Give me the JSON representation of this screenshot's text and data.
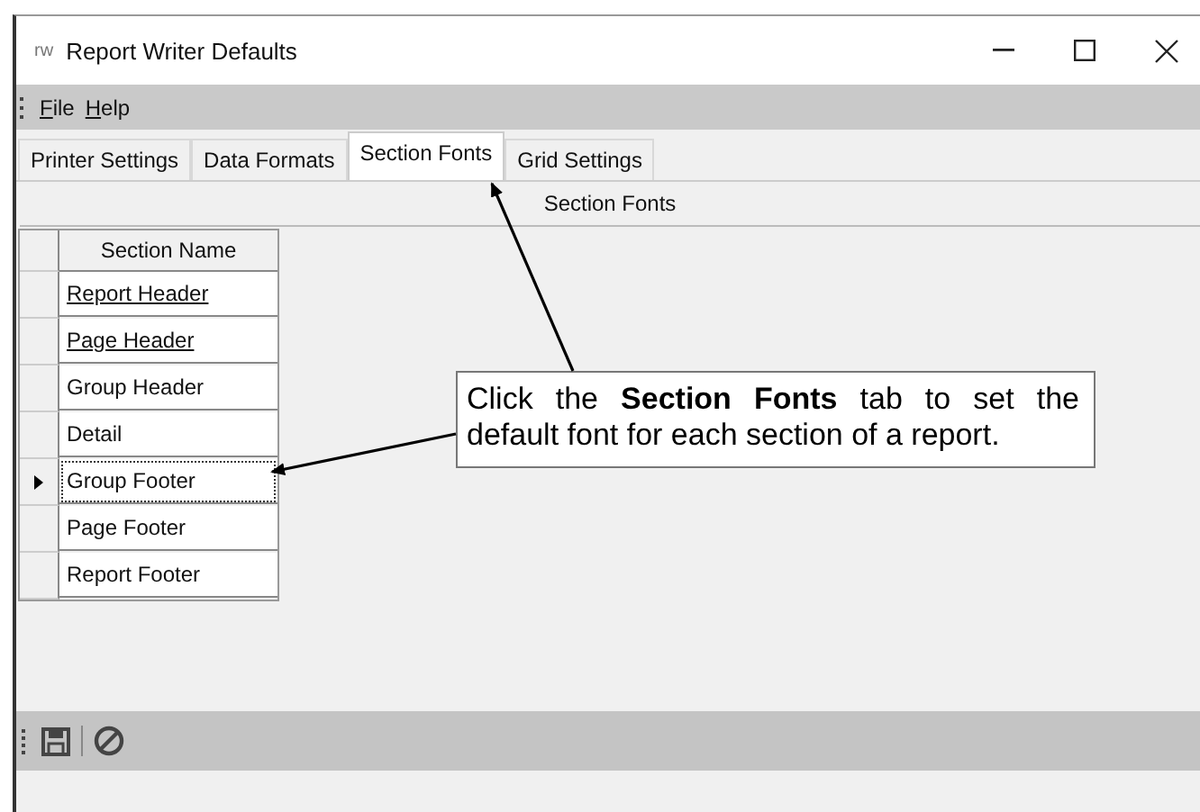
{
  "window": {
    "app_mark": "rw",
    "title": "Report Writer Defaults"
  },
  "menu": [
    {
      "label": "File"
    },
    {
      "label": "Help"
    }
  ],
  "tabs": [
    {
      "label": "Printer Settings",
      "selected": false
    },
    {
      "label": "Data Formats",
      "selected": false
    },
    {
      "label": "Section Fonts",
      "selected": true
    },
    {
      "label": "Grid Settings",
      "selected": false
    }
  ],
  "panel_title": "Section Fonts",
  "table": {
    "columns": [
      "Section Name"
    ],
    "rows": [
      {
        "name": "Report Header",
        "link": true,
        "selected": false
      },
      {
        "name": "Page Header",
        "link": true,
        "selected": false
      },
      {
        "name": "Group Header",
        "link": false,
        "selected": false
      },
      {
        "name": "Detail",
        "link": false,
        "selected": false
      },
      {
        "name": "Group Footer",
        "link": false,
        "selected": true
      },
      {
        "name": "Page Footer",
        "link": false,
        "selected": false
      },
      {
        "name": "Report Footer",
        "link": false,
        "selected": false
      }
    ]
  },
  "callout": "Click the **Section Fonts** tab to set the default font for each section of a report."
}
